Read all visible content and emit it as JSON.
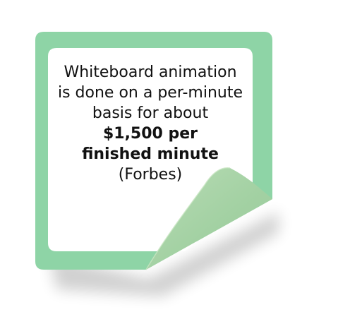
{
  "note": {
    "line1": "Whiteboard animation",
    "line2": "is done on a per-minute",
    "line3": "basis for about",
    "highlight1": "$1,500 per",
    "highlight2": "finished minute",
    "source": "(Forbes)"
  },
  "colors": {
    "frame": "#8ed4a6",
    "inner": "#ffffff",
    "curl": "#a6d3a6",
    "text": "#111111"
  }
}
